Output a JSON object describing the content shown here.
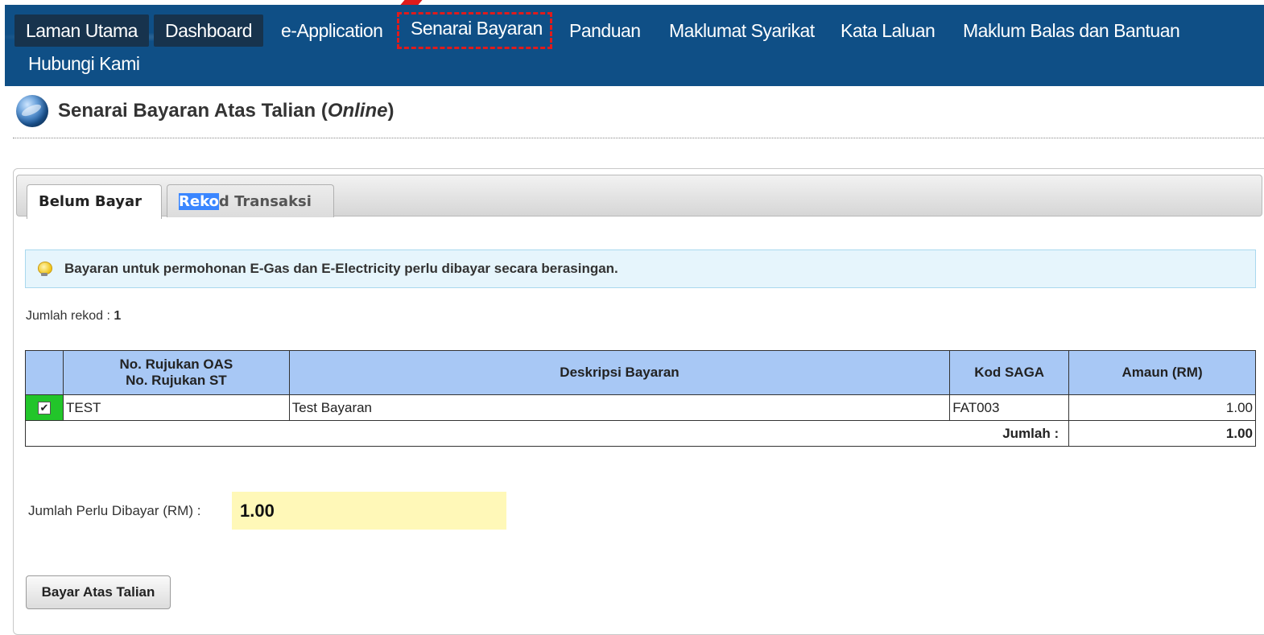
{
  "nav": {
    "items": [
      {
        "label": "Laman Utama"
      },
      {
        "label": "Dashboard"
      },
      {
        "label": "e-Application"
      },
      {
        "label": "Senarai Bayaran"
      },
      {
        "label": "Panduan"
      },
      {
        "label": "Maklumat Syarikat"
      },
      {
        "label": "Kata Laluan"
      },
      {
        "label": "Maklum Balas dan Bantuan"
      },
      {
        "label": "Hubungi Kami"
      }
    ]
  },
  "page": {
    "title_main": "Senarai Bayaran Atas Talian (",
    "title_italic": "Online",
    "title_end": ")"
  },
  "tabs": {
    "active": "Belum Bayar",
    "inactive_selected": "Reko",
    "inactive_rest": "d Transaksi"
  },
  "info": {
    "icon": "lightbulb-icon",
    "text": "Bayaran untuk permohonan E-Gas dan E-Electricity perlu dibayar secara berasingan."
  },
  "records": {
    "label": "Jumlah rekod : ",
    "count": "1"
  },
  "table": {
    "headers": {
      "ref_line1": "No. Rujukan OAS",
      "ref_line2": "No. Rujukan ST",
      "desc": "Deskripsi Bayaran",
      "saga": "Kod SAGA",
      "amount": "Amaun (RM)"
    },
    "rows": [
      {
        "checked": "✔",
        "ref": "TEST",
        "desc": "Test Bayaran",
        "saga": "FAT003",
        "amount": "1.00"
      }
    ],
    "total_label": "Jumlah :",
    "total_value": "1.00"
  },
  "due": {
    "label": "Jumlah Perlu Dibayar (RM) :",
    "value": "1.00"
  },
  "button": {
    "pay_label": "Bayar Atas Talian"
  },
  "colors": {
    "nav_bg": "#0f4f86",
    "header_bg": "#a8c8f5",
    "check_cell": "#22c52a",
    "due_bg": "#fff8b8",
    "highlight": "#e01b1b"
  }
}
